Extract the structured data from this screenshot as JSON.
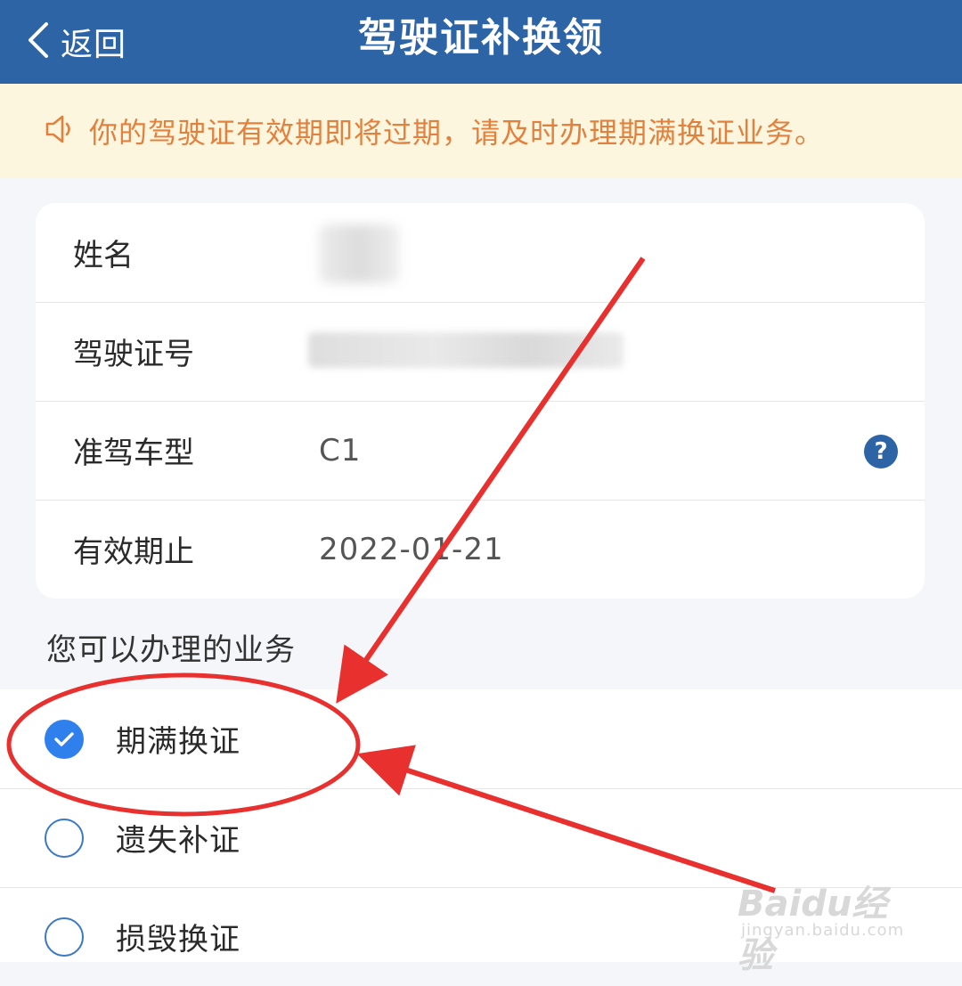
{
  "header": {
    "back_label": "返回",
    "title": "驾驶证补换领"
  },
  "notice": {
    "text": "你的驾驶证有效期即将过期，请及时办理期满换证业务。",
    "color": "#e2813e"
  },
  "info_rows": [
    {
      "label": "姓名",
      "value": ""
    },
    {
      "label": "驾驶证号",
      "value": ""
    },
    {
      "label": "准驾车型",
      "value": "C1"
    },
    {
      "label": "有效期止",
      "value": "2022-01-21"
    }
  ],
  "help_icon": "?",
  "section_title": "您可以办理的业务",
  "options": [
    {
      "label": "期满换证",
      "checked": true
    },
    {
      "label": "遗失补证",
      "checked": false
    },
    {
      "label": "损毁换证",
      "checked": false
    }
  ],
  "watermark": {
    "main": "Baidu经验",
    "sub": "jingyan.baidu.com"
  },
  "colors": {
    "header_bg": "#2c64a6",
    "accent_blue": "#2f80ed",
    "annotation_red": "#e8302f"
  }
}
